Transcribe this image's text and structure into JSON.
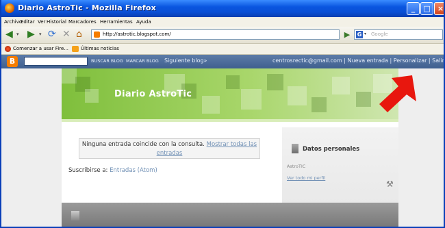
{
  "window": {
    "title": "Diario AstroTic - Mozilla Firefox",
    "controls": [
      "_",
      "□",
      "×"
    ]
  },
  "menu": [
    "Archivo",
    "Editar",
    "Ver",
    "Historial",
    "Marcadores",
    "Herramientas",
    "Ayuda"
  ],
  "nav": {
    "url": "http://astrotic.blogspot.com/",
    "search_placeholder": "Google"
  },
  "bookmarks": [
    {
      "label": "Comenzar a usar Fire...",
      "icon": "firefox-icon"
    },
    {
      "label": "Últimas noticias",
      "icon": "rss-feed-icon"
    }
  ],
  "blogger_bar": {
    "buscar_blog": "BUSCAR BLOG",
    "marcar_blog": "MARCAR BLOG",
    "siguiente": "Siguiente blog»",
    "account": "centrosrectic@gmail.com | Nueva entrada | Personalizar | Salir"
  },
  "blog": {
    "title": "Diario AstroTic",
    "message_text": "Ninguna entrada coincide con la consulta.",
    "message_link": "Mostrar todas las entradas",
    "subscribe_label": "Suscribirse a:",
    "subscribe_link": "Entradas (Atom)",
    "sidebar_heading": "Datos personales",
    "author": "AstroTIC",
    "profile_link": "Ver todo mi perfil"
  },
  "colors": {
    "annotation_arrow": "#e8170e",
    "header_green": "#8cc34c",
    "blogger_bar": "#4f6e9d"
  }
}
